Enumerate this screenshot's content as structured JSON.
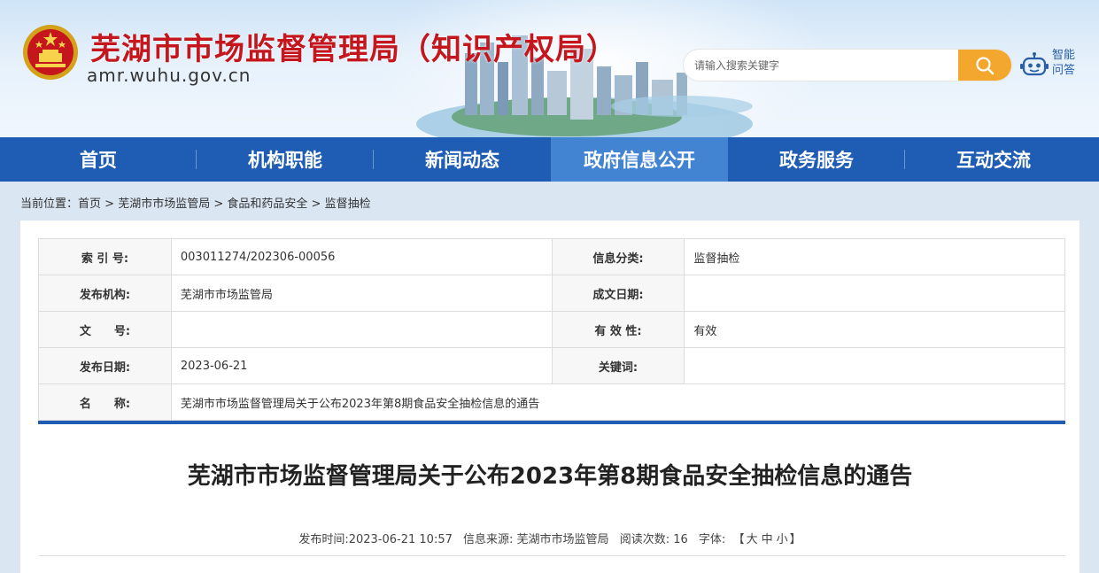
{
  "header": {
    "site_title": "芜湖市市场监督管理局（知识产权局）",
    "site_domain": "amr.wuhu.gov.cn",
    "search_placeholder": "请输入搜索关键字",
    "qa_label": "智能问答",
    "title_color": "#c4161c",
    "search_button_color": "#f3a72c"
  },
  "nav": {
    "items": [
      "首页",
      "机构职能",
      "新闻动态",
      "政府信息公开",
      "政务服务",
      "互动交流"
    ],
    "active": "政府信息公开",
    "bg_color": "#1e5db3",
    "active_color": "#4384d2"
  },
  "breadcrumb": {
    "prefix": "当前位置：",
    "items": [
      "首页",
      "芜湖市市场监管局",
      "食品和药品安全",
      "监督抽检"
    ],
    "separator": " > "
  },
  "meta": {
    "rows": [
      {
        "l1": "索 引 号:",
        "v1": "003011274/202306-00056",
        "l2": "信息分类:",
        "v2": "监督抽检"
      },
      {
        "l1": "发布机构:",
        "v1": "芜湖市市场监管局",
        "l2": "成文日期:",
        "v2": ""
      },
      {
        "l1": "文　　号:",
        "v1": "",
        "l2": "有 效 性:",
        "v2": "有效"
      },
      {
        "l1": "发布日期:",
        "v1": "2023-06-21",
        "l2": "关键词:",
        "v2": ""
      }
    ],
    "name_label": "名　　称:",
    "name_value": "芜湖市市场监督管理局关于公布2023年第8期食品安全抽检信息的通告"
  },
  "article": {
    "title": "芜湖市市场监督管理局关于公布2023年第8期食品安全抽检信息的通告",
    "publish_time_label": "发布时间:",
    "publish_time": "2023-06-21 10:57",
    "source_label": "信息来源:",
    "source": "芜湖市市场监管局",
    "views_label": "阅读次数:",
    "views": "16",
    "font_label": "字体:",
    "font_open": "【",
    "font_large": "大",
    "font_medium": "中",
    "font_small": "小",
    "font_close": "】"
  }
}
